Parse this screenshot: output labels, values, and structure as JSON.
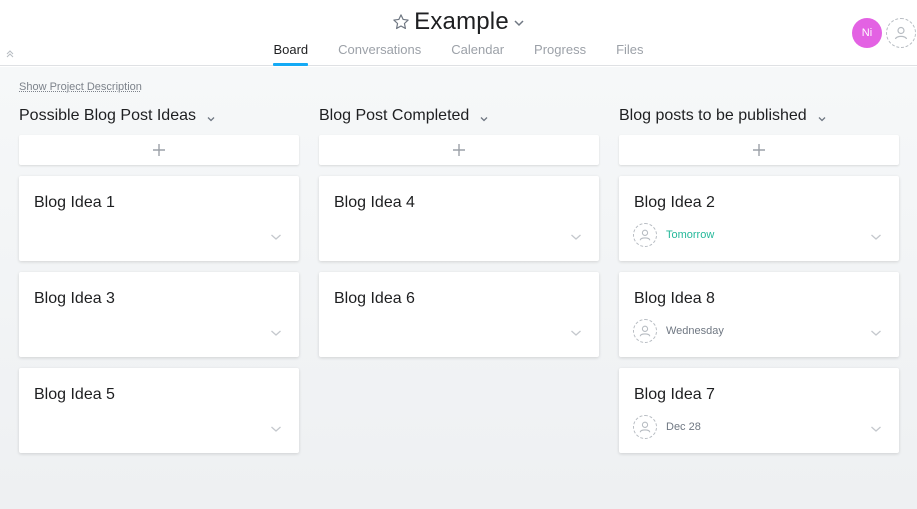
{
  "header": {
    "title": "Example",
    "tabs": [
      "Board",
      "Conversations",
      "Calendar",
      "Progress",
      "Files"
    ],
    "active_tab": "Board",
    "avatar_initials": "Ni"
  },
  "board": {
    "show_description": "Show Project Description",
    "columns": [
      {
        "title": "Possible Blog Post Ideas",
        "cards": [
          {
            "title": "Blog Idea 1",
            "due": ""
          },
          {
            "title": "Blog Idea 3",
            "due": ""
          },
          {
            "title": "Blog Idea 5",
            "due": ""
          }
        ]
      },
      {
        "title": "Blog Post Completed",
        "cards": [
          {
            "title": "Blog Idea 4",
            "due": ""
          },
          {
            "title": "Blog Idea 6",
            "due": ""
          }
        ]
      },
      {
        "title": "Blog posts to be published",
        "cards": [
          {
            "title": "Blog Idea 2",
            "due": "Tomorrow"
          },
          {
            "title": "Blog Idea 8",
            "due": "Wednesday"
          },
          {
            "title": "Blog Idea 7",
            "due": "Dec 28"
          }
        ]
      }
    ]
  },
  "colors": {
    "accent_tab": "#14aaf5",
    "avatar": "#e362e3",
    "due_soon": "#25b89a"
  }
}
